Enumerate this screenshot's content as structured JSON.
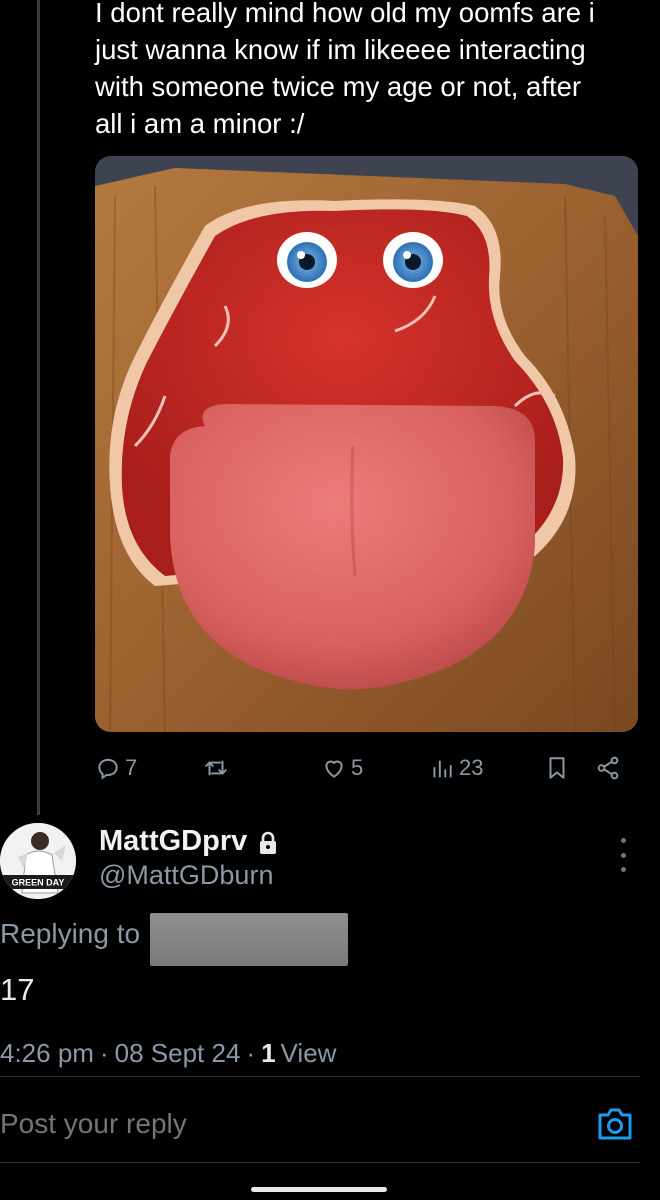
{
  "tweet": {
    "text": "I dont really mind how old my oomfs are i\njust wanna know if im likeeee interacting\nwith someone twice my age or not, after\nall i am a minor :/",
    "media_description": "red meat steak with cartoon eyes and tongue on a cutting board",
    "actions": {
      "reply_count": "7",
      "repost_count": "",
      "like_count": "5",
      "view_count": "23"
    }
  },
  "reply": {
    "display_name": "MattGDprv",
    "handle": "@MattGDburn",
    "avatar_text": "GREEN DAY",
    "replying_to_label": "Replying to",
    "text": "17",
    "time": "4:26 pm",
    "separator": "·",
    "date": "08 Sept 24",
    "views_count": "1",
    "views_label": "View"
  },
  "composer": {
    "placeholder": "Post your reply"
  },
  "colors": {
    "background": "#000000",
    "text_primary": "#e7e9ea",
    "text_secondary": "#8b98a5",
    "accent": "#1d9bf0"
  }
}
